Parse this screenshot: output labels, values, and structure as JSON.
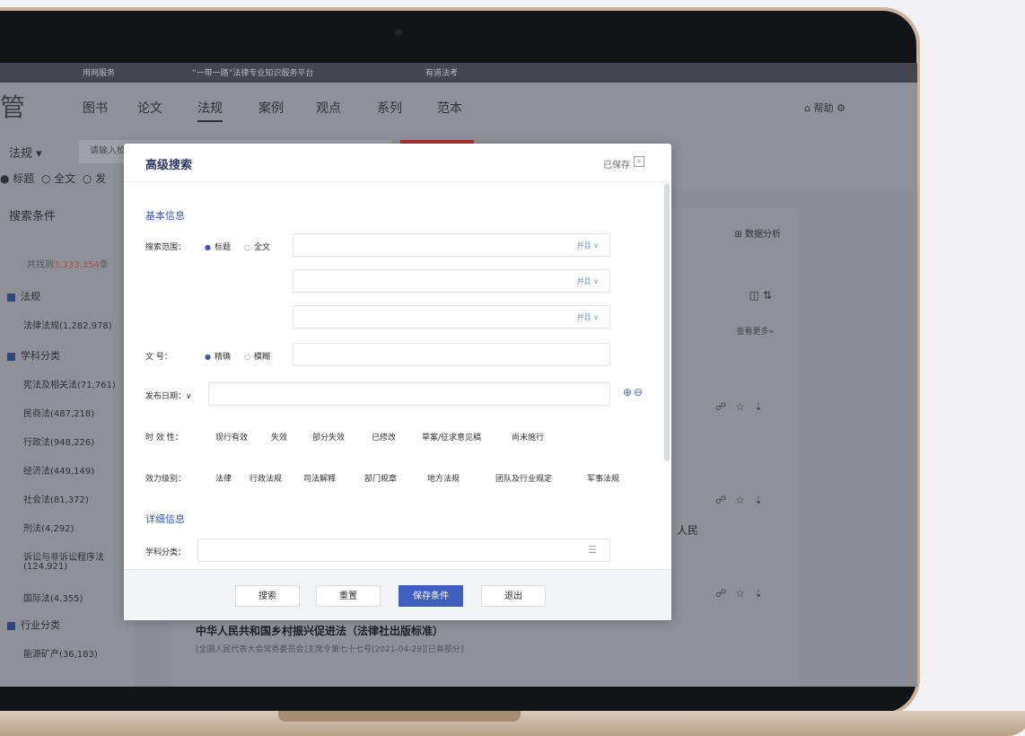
{
  "topbar": {
    "left": "用网服务",
    "center": "“一带一路”法律专业知识服务平台",
    "right": "有道法考"
  },
  "nav": {
    "logo": "管",
    "items": [
      "图书",
      "论文",
      "法规",
      "案例",
      "观点",
      "系列",
      "范本"
    ],
    "active": "法规",
    "right": "帮助"
  },
  "search": {
    "select": "法规 ▾",
    "placeholder": "请输入检索",
    "radios": [
      "● 标题",
      "○ 全文",
      "○ 发"
    ]
  },
  "sidebar": {
    "heading": "搜索条件",
    "total_prefix": "共找到",
    "total_value": "3,333,354",
    "total_suffix": "条",
    "cat1": "法规",
    "cat1_item": "法律法规(1,282,978)",
    "cat2": "学科分类",
    "items": [
      "宪法及相关法(71,761)",
      "民商法(487,218)",
      "行政法(948,226)",
      "经济法(449,149)",
      "社会法(81,372)",
      "刑法(4,292)",
      "诉讼与非诉讼程序法",
      "(124,921)",
      "国际法(4,355)"
    ],
    "cat3": "行业分类",
    "cat3_item": "能源矿产(36,183)"
  },
  "results": {
    "analysis": "⊞ 数据分析",
    "icons": "◫   ⇅",
    "more": "查看更多»",
    "actions": "☍☆⇣",
    "fragment": "人民",
    "bottom_title": "中华人民共和国乡村振兴促进法（法律社出版标准）",
    "bottom_sub": "[全国人民代表大会常务委员会]主席令第七十七号[2021-04-29][已有部分]"
  },
  "modal": {
    "title": "高级搜索",
    "saved": "已保存",
    "section_basic": "基本信息",
    "scope_label": "搜索范围：",
    "scope_on": "标题",
    "scope_off": "全文",
    "dd_label": "并且 ∨",
    "docno_label": "文 号：",
    "docno_on": "精确",
    "docno_off": "模糊",
    "date_label": "发布日期：∨",
    "plusminus": "⊕⊖",
    "validity_label": "时 效 性：",
    "validity": [
      "现行有效",
      "失效",
      "部分失效",
      "已修改",
      "草案/征求意见稿",
      "尚未施行"
    ],
    "level_label": "效力级别：",
    "level": [
      "法律",
      "行政法规",
      "司法解释",
      "部门规章",
      "地方法规",
      "团队及行业规定",
      "军事法规"
    ],
    "section_detail": "详细信息",
    "subject_label": "学科分类：",
    "buttons": [
      "搜索",
      "重置",
      "保存条件",
      "退出"
    ]
  }
}
